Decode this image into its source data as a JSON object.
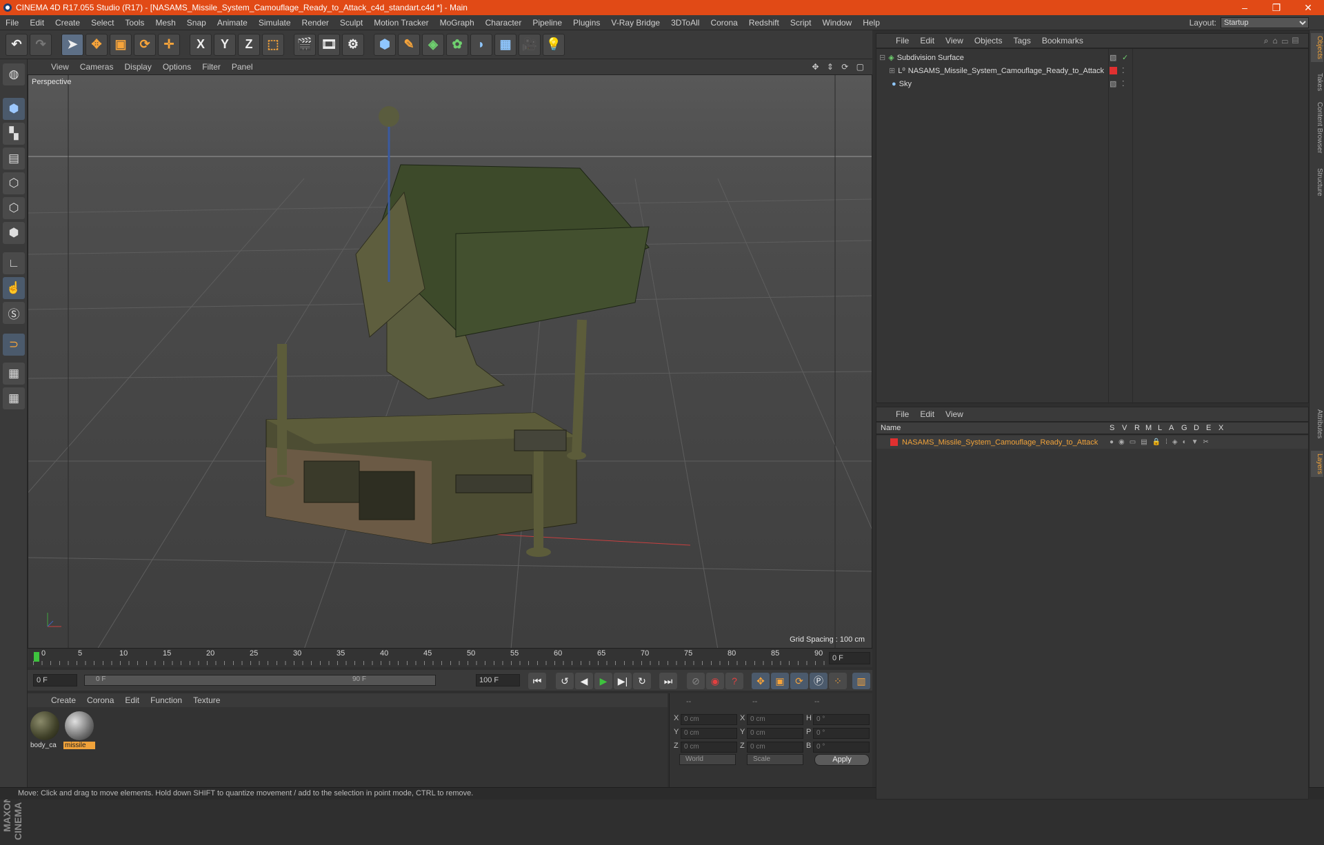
{
  "title": "CINEMA 4D R17.055 Studio (R17) - [NASAMS_Missile_System_Camouflage_Ready_to_Attack_c4d_standart.c4d *] - Main",
  "window_buttons": {
    "minimize": "–",
    "maximize": "❐",
    "close": "✕"
  },
  "menu": [
    "File",
    "Edit",
    "Create",
    "Select",
    "Tools",
    "Mesh",
    "Snap",
    "Animate",
    "Simulate",
    "Render",
    "Sculpt",
    "Motion Tracker",
    "MoGraph",
    "Character",
    "Pipeline",
    "Plugins",
    "V-Ray Bridge",
    "3DToAll",
    "Corona",
    "Redshift",
    "Script",
    "Window",
    "Help"
  ],
  "layout": {
    "label": "Layout:",
    "value": "Startup"
  },
  "toolbar": {
    "undo": "↶",
    "redo": "↷",
    "x": "X",
    "y": "Y",
    "z": "Z"
  },
  "viewport": {
    "menu": [
      "View",
      "Cameras",
      "Display",
      "Options",
      "Filter",
      "Panel"
    ],
    "label": "Perspective",
    "grid_spacing": "Grid Spacing : 100 cm",
    "nav_icons": "✥ ⇕ ⟳ ▢"
  },
  "timeline": {
    "ticks": [
      "0",
      "5",
      "10",
      "15",
      "20",
      "25",
      "30",
      "35",
      "40",
      "45",
      "50",
      "55",
      "60",
      "65",
      "70",
      "75",
      "80",
      "85",
      "90"
    ],
    "current": "0 F",
    "start": "0 F",
    "range_start": "0 F",
    "range_end": "90 F",
    "end": "100 F"
  },
  "playback": {
    "first": "⏮",
    "prev_key": "↺",
    "prev": "◀",
    "play": "▶",
    "next": "▶|",
    "next_key": "↻",
    "last": "⏭"
  },
  "material": {
    "menu": [
      "Create",
      "Corona",
      "Edit",
      "Function",
      "Texture"
    ],
    "items": [
      {
        "label": "body_ca"
      },
      {
        "label": "missile"
      }
    ]
  },
  "coords": {
    "headers": [
      "--",
      "--",
      "--"
    ],
    "rows": [
      {
        "a": "X",
        "av": "0 cm",
        "b": "X",
        "bv": "0 cm",
        "c": "H",
        "cv": "0 °"
      },
      {
        "a": "Y",
        "av": "0 cm",
        "b": "Y",
        "bv": "0 cm",
        "c": "P",
        "cv": "0 °"
      },
      {
        "a": "Z",
        "av": "0 cm",
        "b": "Z",
        "bv": "0 cm",
        "c": "B",
        "cv": "0 °"
      }
    ],
    "mode": "World",
    "scale": "Scale",
    "apply": "Apply"
  },
  "status": "Move: Click and drag to move elements. Hold down SHIFT to quantize movement / add to the selection in point mode, CTRL to remove.",
  "objects": {
    "menu": [
      "File",
      "Edit",
      "View",
      "Objects",
      "Tags",
      "Bookmarks"
    ],
    "rows": [
      {
        "name": "Subdivision Surface"
      },
      {
        "name": "NASAMS_Missile_System_Camouflage_Ready_to_Attack"
      },
      {
        "name": "Sky"
      }
    ]
  },
  "layers": {
    "menu": [
      "File",
      "Edit",
      "View"
    ],
    "name_header": "Name",
    "flags": [
      "S",
      "V",
      "R",
      "M",
      "L",
      "A",
      "G",
      "D",
      "E",
      "X"
    ],
    "row": "NASAMS_Missile_System_Camouflage_Ready_to_Attack"
  },
  "side_tabs": [
    "Objects",
    "Takes",
    "Content Browser",
    "Structure",
    "Attributes",
    "Layers"
  ],
  "logo": "MAXON CINEMA 4D",
  "colors": {
    "titlebar": "#e14a16",
    "accent": "#f0a23a",
    "layer_red": "#e03030"
  }
}
